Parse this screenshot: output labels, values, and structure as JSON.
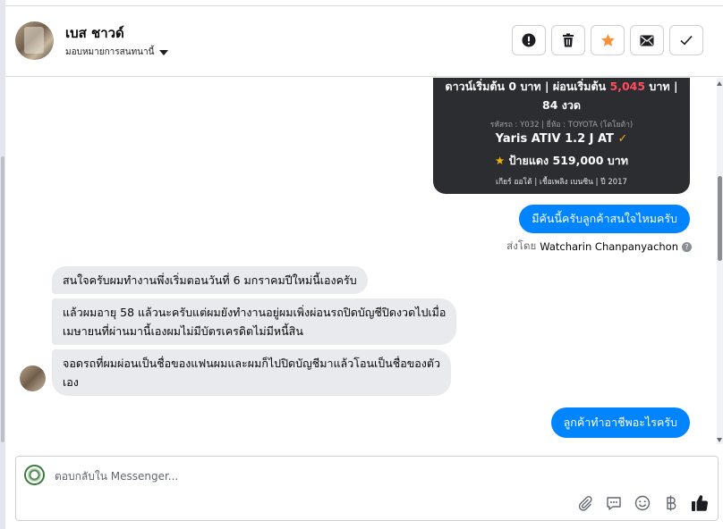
{
  "header": {
    "contact_name": "เบส ชาวด์",
    "assign_label": "มอบหมายการสนทนานี้"
  },
  "product_card": {
    "line1_prefix": "ดาวน์เริ่มต้น 0 บาท | ผ่อนเริ่มต้น ",
    "line1_amount": "5,045",
    "line1_suffix": " บาท |",
    "line2": "84 งวด",
    "meta": "รหัสรถ : Y032 | ยี่ห้อ : TOYOTA (โตโยต้า)",
    "model": "Yaris ATIV 1.2 J AT",
    "price": "ป้ายแดง 519,000 บาท",
    "specs": "เกียร์ ออโต้ | เชื้อเพลิง เบนซิน | ปี 2017"
  },
  "messages": {
    "out1": "มีคันนี้ครับลูกค้าสนใจไหมครับ",
    "sent_by_prefix": "ส่งโดย",
    "sent_by_name": "Watcharin Chanpanyachon",
    "in1": "สนใจครับผมทำงานพึ่งเริ่มตอนวันที่ 6 มกราคมปีใหม่นี้เองครับ",
    "in2_line1": "แล้วผมอายุ 58 แล้วนะครับแต่ผมยังทำงานอยู่ผมเพิ่งผ่อนรถปิดบัญชีปิดงวดไปเมื่อ",
    "in2_line2": "เมษายนที่ผ่านมานี้เองผมไม่มีบัตรเครดิตไม่มีหนี้สิน",
    "in3_line1": "จอดรถที่ผมผ่อนเป็นชื่อของแฟนผมและผมก็ไปปิดบัญชีมาแล้วโอนเป็นชื่อของตัว",
    "in3_line2": "เอง",
    "out2": "ลูกค้าทำอาชีพอะไรครับ"
  },
  "composer": {
    "placeholder": "ตอบกลับใน Messenger..."
  },
  "icons": {
    "header_actions": [
      "report-icon",
      "trash-icon",
      "star-icon",
      "mail-icon",
      "check-icon"
    ],
    "composer_tools": [
      "attachment-icon",
      "saved-reply-icon",
      "emoji-icon",
      "baht-icon",
      "thumbs-up-icon"
    ]
  },
  "colors": {
    "messenger_blue": "#0084ff",
    "star_orange": "#f7923a",
    "card_dark": "#2c2d30",
    "price_red": "#ff4d5e"
  }
}
